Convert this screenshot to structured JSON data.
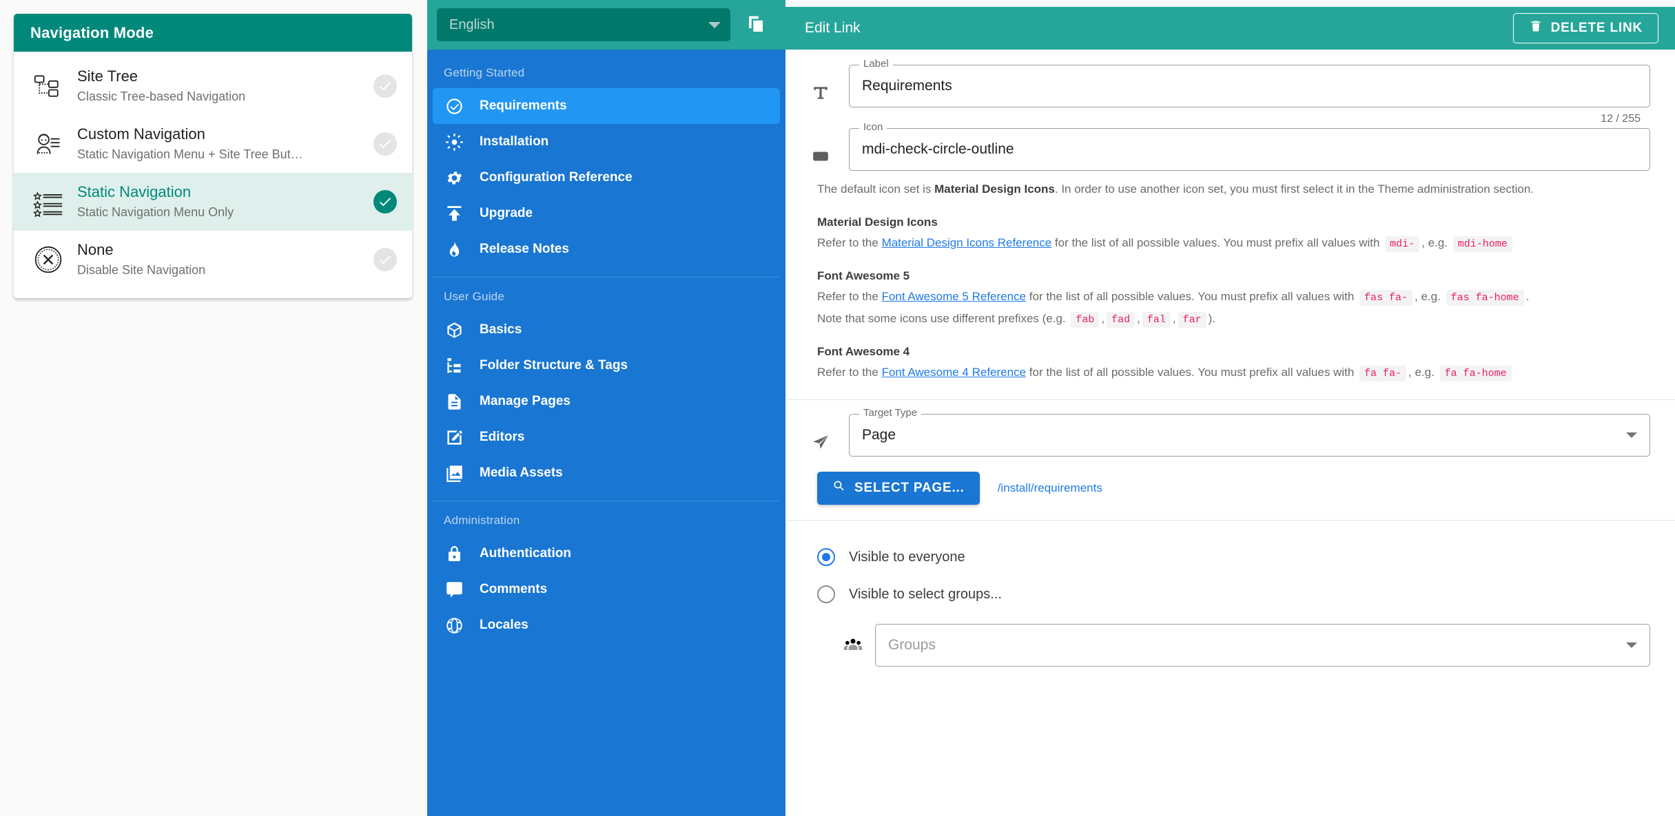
{
  "nav_mode_card": {
    "header_title": "Navigation Mode",
    "items": [
      {
        "icon": "site-tree-icon",
        "title": "Site Tree",
        "subtitle": "Classic Tree-based Navigation",
        "selected": false
      },
      {
        "icon": "custom-navigation-icon",
        "title": "Custom Navigation",
        "subtitle": "Static Navigation Menu + Site Tree But…",
        "selected": false
      },
      {
        "icon": "static-navigation-icon",
        "title": "Static Navigation",
        "subtitle": "Static Navigation Menu Only",
        "selected": true
      },
      {
        "icon": "none-disabled-icon",
        "title": "None",
        "subtitle": "Disable Site Navigation",
        "selected": false
      }
    ]
  },
  "sidebar": {
    "language_selector": {
      "value": "English",
      "icon": "chevron-down-icon"
    },
    "copy_button_icon": "copy-icon",
    "groups": [
      {
        "title": "Getting Started",
        "items": [
          {
            "label": "Requirements",
            "icon": "check-circle-outline-icon",
            "active": true
          },
          {
            "label": "Installation",
            "icon": "brightness-icon",
            "active": false
          },
          {
            "label": "Configuration Reference",
            "icon": "cog-icon",
            "active": false
          },
          {
            "label": "Upgrade",
            "icon": "upload-icon",
            "active": false
          },
          {
            "label": "Release Notes",
            "icon": "fire-icon",
            "active": false
          }
        ]
      },
      {
        "title": "User Guide",
        "items": [
          {
            "label": "Basics",
            "icon": "cube-icon",
            "active": false
          },
          {
            "label": "Folder Structure & Tags",
            "icon": "file-tree-icon",
            "active": false
          },
          {
            "label": "Manage Pages",
            "icon": "file-document-icon",
            "active": false
          },
          {
            "label": "Editors",
            "icon": "pencil-box-icon",
            "active": false
          },
          {
            "label": "Media Assets",
            "icon": "image-multiple-icon",
            "active": false
          }
        ]
      },
      {
        "title": "Administration",
        "items": [
          {
            "label": "Authentication",
            "icon": "lock-icon",
            "active": false
          },
          {
            "label": "Comments",
            "icon": "comment-icon",
            "active": false
          },
          {
            "label": "Locales",
            "icon": "globe-icon",
            "active": false
          }
        ]
      }
    ]
  },
  "editor": {
    "header": {
      "title": "Edit Link",
      "delete_label": "DELETE LINK",
      "delete_icon": "trash-icon"
    },
    "label_field": {
      "label": "Label",
      "value": "Requirements",
      "icon": "format-text-icon",
      "counter": "12 / 255"
    },
    "icon_field": {
      "label": "Icon",
      "value": "mdi-check-circle-outline",
      "icon": "dice-icon"
    },
    "help": {
      "intro_pre": "The default icon set is ",
      "intro_bold": "Material Design Icons",
      "intro_post": ". In order to use another icon set, you must first select it in the Theme administration section.",
      "sections": [
        {
          "heading": "Material Design Icons",
          "pre": "Refer to the ",
          "link": "Material Design Icons Reference",
          "mid": " for the list of all possible values. You must prefix all values with ",
          "chip1": "mdi-",
          "eg": ", e.g. ",
          "chip2": "mdi-home",
          "post": "",
          "note": null
        },
        {
          "heading": "Font Awesome 5",
          "pre": "Refer to the ",
          "link": "Font Awesome 5 Reference",
          "mid": " for the list of all possible values. You must prefix all values with ",
          "chip1": "fas fa-",
          "eg": ", e.g. ",
          "chip2": "fas fa-home",
          "post": ".",
          "note": {
            "pre": "Note that some icons use different prefixes (e.g. ",
            "chips": [
              "fab",
              "fad",
              "fal",
              "far"
            ],
            "post": ")."
          }
        },
        {
          "heading": "Font Awesome 4",
          "pre": "Refer to the ",
          "link": "Font Awesome 4 Reference",
          "mid": " for the list of all possible values. You must prefix all values with ",
          "chip1": "fa fa-",
          "eg": ", e.g. ",
          "chip2": "fa fa-home",
          "post": "",
          "note": null
        }
      ]
    },
    "target_type_field": {
      "label": "Target Type",
      "value": "Page",
      "icon": "navigation-icon"
    },
    "select_page": {
      "label": "SELECT PAGE...",
      "icon": "magnify-icon",
      "path": "/install/requirements"
    },
    "visibility": {
      "everyone_label": "Visible to everyone",
      "everyone_checked": true,
      "groups_label": "Visible to select groups...",
      "groups_checked": false,
      "groups_input": {
        "placeholder": "Groups",
        "icon": "account-group-icon"
      }
    }
  },
  "colors": {
    "teal_header": "#00897a",
    "teal_bar": "#26a69a",
    "teal_select": "#00796b",
    "blue_sidebar": "#1976d2",
    "blue_active": "#2196f3",
    "selected_row_bg": "#dff0ec",
    "link_blue": "#1e7ae8",
    "code_pink": "#e91e63"
  }
}
